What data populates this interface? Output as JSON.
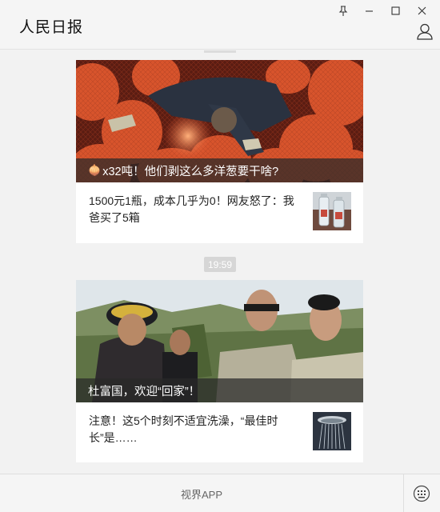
{
  "window": {
    "title": "人民日报",
    "controls": [
      "pin-icon",
      "minimize-icon",
      "maximize-icon",
      "close-icon"
    ]
  },
  "feed": {
    "articles": [
      {
        "hero_emoji": "🧅",
        "hero_caption": "x32吨！他们剥这么多洋葱要干啥?",
        "sub_title": "1500元1瓶，成本几乎为0！网友怒了：我爸买了5箱"
      },
      {
        "hero_caption": "杜富国，欢迎“回家”！",
        "sub_title": "注意！这5个时刻不适宜洗澡，“最佳时长”是……"
      }
    ],
    "time_badge": "19:59"
  },
  "bottom_bar": {
    "visit_label": "视界APP",
    "keyboard_icon": "keyboard-icon"
  },
  "colors": {
    "background": "#f2f2f2",
    "caption_overlay": "#2b2b2b",
    "time_badge": "#d6d6d6"
  }
}
